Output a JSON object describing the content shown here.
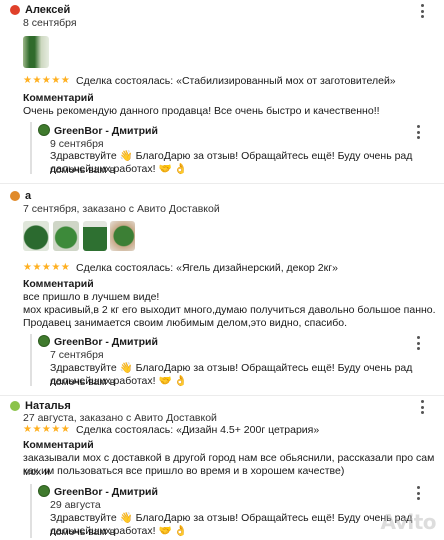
{
  "reviews": [
    {
      "author": "Алексей",
      "avatar_color": "#e0402a",
      "date": "8 сентября",
      "photos": 1,
      "stars": "★★★★★",
      "deal": "Сделка состоялась: «Стабилизированный мох от заготовителей»",
      "comment_label": "Комментарий",
      "comment": [
        "Очень рекомендую данного продавца! Все очень быстро и качественно!!"
      ],
      "reply": {
        "author": "GreenBor - Дмитрий",
        "date": "9 сентября",
        "text": [
          "Здравствуйте 👋 БлагоДарю за отзыв! Обращайтесь ещё! Буду очень рад помочь вам в",
          "дальнейших работах! 🤝 👌"
        ]
      }
    },
    {
      "author": "а",
      "avatar_color": "#e08a2a",
      "date": "7 сентября, заказано с Авито Доставкой",
      "photos": 4,
      "stars": "★★★★★",
      "deal": "Сделка состоялась: «Ягель дизайнерский, декор 2кг»",
      "comment_label": "Комментарий",
      "comment": [
        "все пришло в лучшем виде!",
        "мох красивый,в 2 кг его выходит много,думаю получиться давольно большое панно.",
        "Продавец занимается своим любимым делом,это видно, спасибо."
      ],
      "reply": {
        "author": "GreenBor - Дмитрий",
        "date": "7 сентября",
        "text": [
          "Здравствуйте 👋 БлагоДарю за отзыв! Обращайтесь ещё! Буду очень рад помочь вам в",
          "дальнейших работах! 🤝 👌"
        ]
      }
    },
    {
      "author": "Наталья",
      "avatar_color": "#8bc34a",
      "date": "27 августа, заказано с Авито Доставкой",
      "photos": 0,
      "stars": "★★★★★",
      "deal": "Сделка состоялась: «Дизайн 4.5+ 200г цетрария»",
      "comment_label": "Комментарий",
      "comment": [
        "заказывали мох с доставкой в другой город нам все обьяснили, рассказали про сам мох и",
        "как им пользоваться все пришло во время и в хорошем качестве)"
      ],
      "reply": {
        "author": "GreenBor - Дмитрий",
        "date": "29 августа",
        "text": [
          "Здравствуйте 👋 БлагоДарю за отзыв! Обращайтесь ещё! Буду очень рад помочь вам в",
          "дальнейших работах! 🤝 👌"
        ]
      }
    }
  ],
  "watermark": "Avito"
}
